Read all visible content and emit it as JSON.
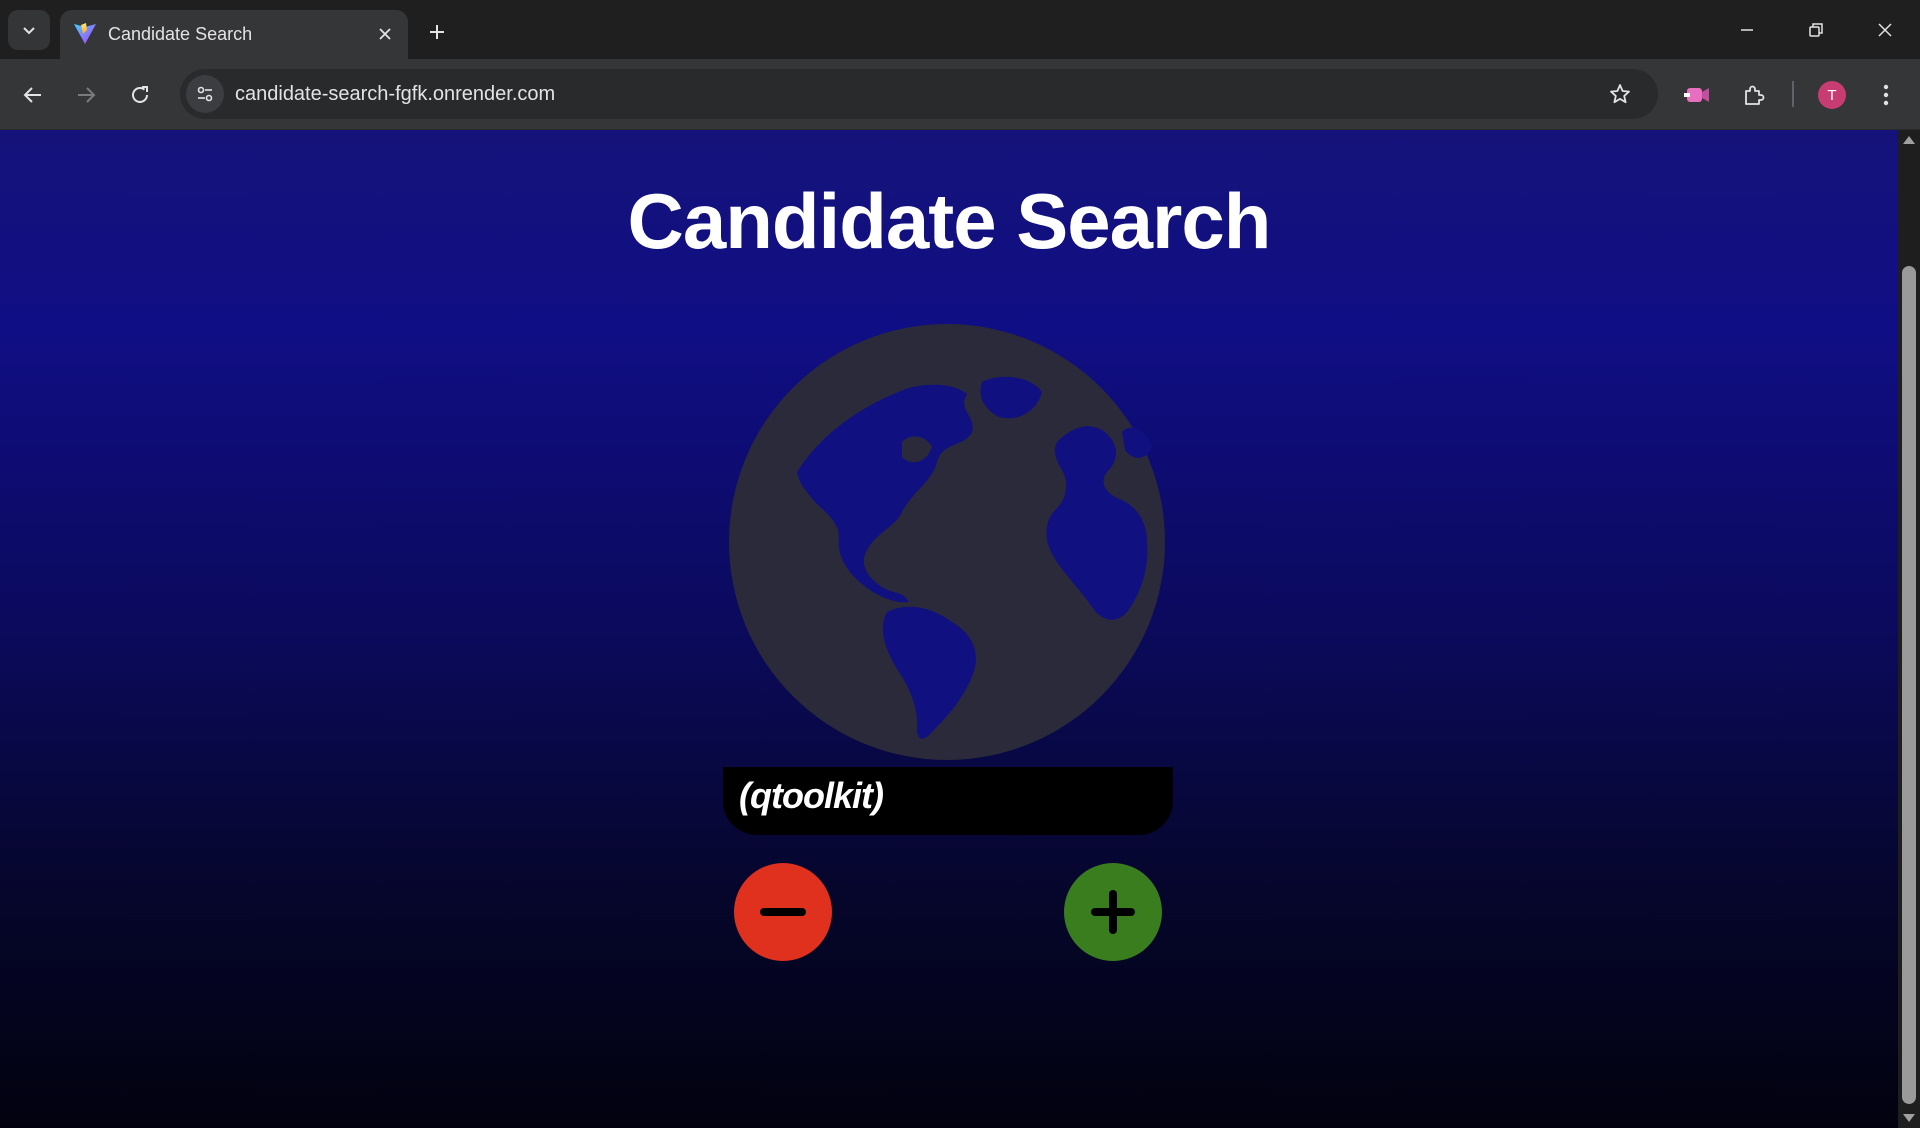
{
  "browser": {
    "tab": {
      "title": "Candidate Search",
      "favicon": "vite-logo-icon"
    },
    "address_bar": {
      "url": "candidate-search-fgfk.onrender.com"
    },
    "profile": {
      "initial": "T",
      "color": "#c83c74"
    }
  },
  "page": {
    "title": "Candidate Search",
    "candidate": {
      "login": "(qtoolkit)",
      "avatar": "globe-icon"
    },
    "actions": {
      "reject": {
        "icon": "minus-icon",
        "color": "#e0301e"
      },
      "accept": {
        "icon": "plus-icon",
        "color": "#3a7d1e"
      }
    }
  },
  "colors": {
    "background_top": "#15137a",
    "background_bottom": "#02020f",
    "name_card": "#000000",
    "globe": "#2a2a3a"
  }
}
